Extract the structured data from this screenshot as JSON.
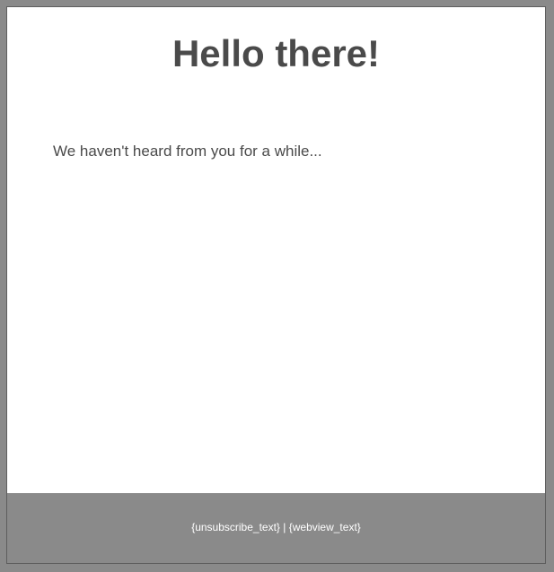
{
  "email": {
    "headline": "Hello there!",
    "message": "We haven't heard from you for a while..."
  },
  "footer": {
    "unsubscribe_label": "{unsubscribe_text}",
    "separator": " | ",
    "webview_label": "{webview_text}"
  },
  "colors": {
    "page_background": "#8a8a8a",
    "card_background": "#ffffff",
    "text": "#4a4a4a",
    "footer_background": "#8a8a8a",
    "footer_text": "#ffffff"
  }
}
